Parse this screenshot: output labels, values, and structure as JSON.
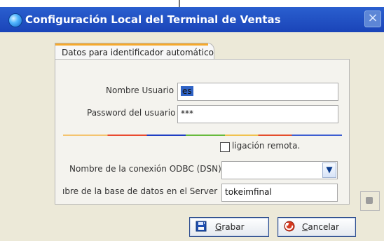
{
  "window": {
    "title": "Configuración Local del Terminal de Ventas",
    "close_label": "×"
  },
  "tabs": [
    {
      "label": "Datos para identificador automático"
    }
  ],
  "form": {
    "usuario_label": "Nombre Usuario",
    "usuario_value": "es",
    "password_label": "Password del usuario",
    "password_value": "***",
    "checkbox_label": "ligación remota.",
    "odbc_label": "Nombre de la conexión ODBC (DSN)",
    "odbc_value": "",
    "base_label": "ıbre de la base de datos en el Server",
    "base_value": "tokeimfinal"
  },
  "buttons": {
    "grabar_prefix": "G",
    "grabar_rest": "rabar",
    "cancelar_prefix": "C",
    "cancelar_rest": "ancelar"
  },
  "colors": {
    "titlebar": "#1a44b8",
    "accent": "#f6a92c",
    "selection": "#2f63c6"
  },
  "icons": {
    "window": "app-globe-icon",
    "grabar": "save-icon",
    "cancelar": "cancel-icon",
    "dropdown": "chevron-down-icon"
  }
}
